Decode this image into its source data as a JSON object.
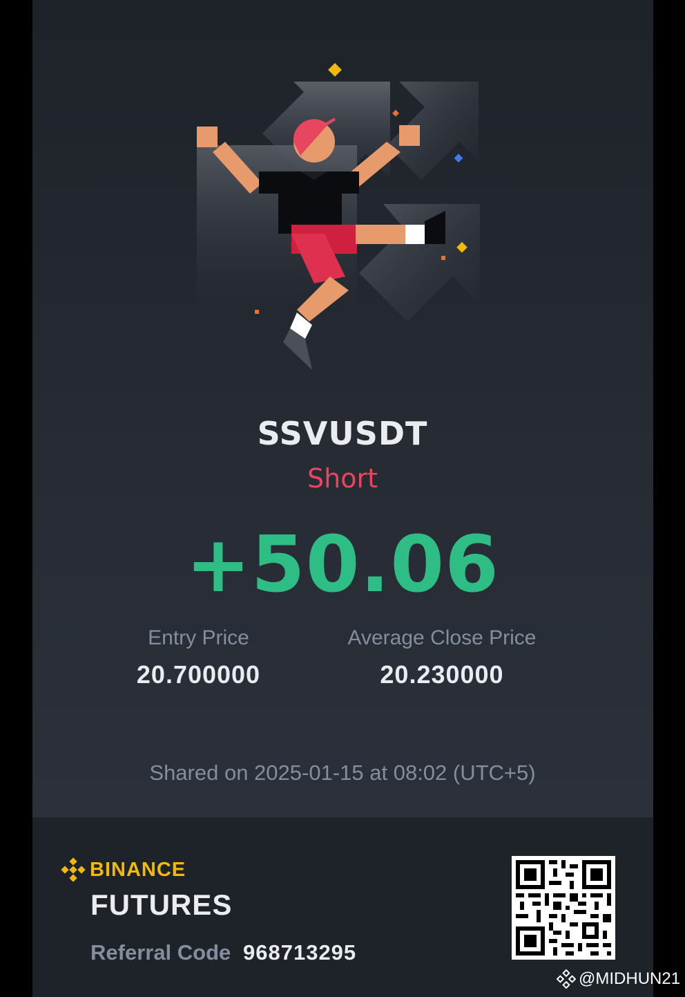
{
  "trade": {
    "pair": "SSVUSDT",
    "side": "Short",
    "pnl": "+50.06",
    "entry_label": "Entry Price",
    "entry_value": "20.700000",
    "close_label": "Average Close Price",
    "close_value": "20.230000",
    "shared_text": "Shared on 2025-01-15 at 08:02 (UTC+5)"
  },
  "footer": {
    "brand": "BINANCE",
    "product": "FUTURES",
    "referral_label": "Referral Code",
    "referral_code": "968713295"
  },
  "watermark": "@MIDHUN21",
  "colors": {
    "background": "#262b34",
    "footer": "#1e2229",
    "pair_text": "#eaecef",
    "short": "#e8465f",
    "profit": "#2ebd85",
    "muted": "#848e9c",
    "brand": "#f0b90b"
  },
  "icons": {
    "hero": "celebrating-runner-illustration",
    "logo": "binance-logo-icon",
    "qr": "qr-code",
    "watermark_logo": "binance-logo-icon"
  }
}
